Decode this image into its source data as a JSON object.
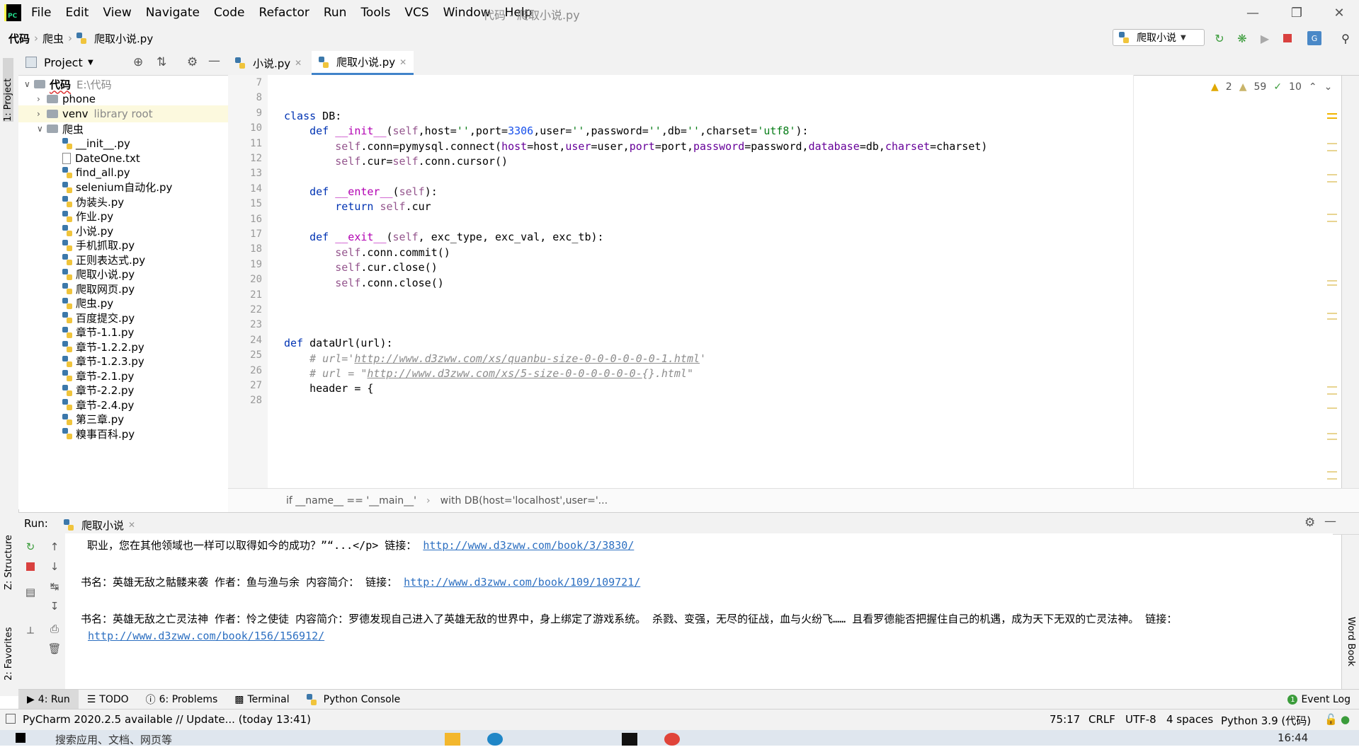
{
  "menubar": {
    "items": [
      "File",
      "Edit",
      "View",
      "Navigate",
      "Code",
      "Refactor",
      "Run",
      "Tools",
      "VCS",
      "Window",
      "Help"
    ],
    "title": "代码 - 爬取小说.py",
    "logo": "PC"
  },
  "navbar": {
    "crumbs": [
      "代码",
      "爬虫",
      "爬取小说.py"
    ],
    "run_config": "爬取小说"
  },
  "left_strip": {
    "project": "1: Project",
    "structure": "Z: Structure",
    "favorites": "2: Favorites"
  },
  "right_strip": {
    "wordbook": "Word Book"
  },
  "project": {
    "title": "Project",
    "root": {
      "name": "代码",
      "path": "E:\\代码"
    },
    "items": [
      {
        "name": "phone",
        "type": "folder"
      },
      {
        "name": "venv",
        "type": "folder",
        "note": "library root"
      },
      {
        "name": "爬虫",
        "type": "folder"
      },
      {
        "name": "__init__.py",
        "type": "py"
      },
      {
        "name": "DateOne.txt",
        "type": "txt"
      },
      {
        "name": "find_all.py",
        "type": "py"
      },
      {
        "name": "selenium自动化.py",
        "type": "py"
      },
      {
        "name": "伪装头.py",
        "type": "py"
      },
      {
        "name": "作业.py",
        "type": "py"
      },
      {
        "name": "小说.py",
        "type": "py"
      },
      {
        "name": "手机抓取.py",
        "type": "py"
      },
      {
        "name": "正则表达式.py",
        "type": "py"
      },
      {
        "name": "爬取小说.py",
        "type": "py"
      },
      {
        "name": "爬取网页.py",
        "type": "py"
      },
      {
        "name": "爬虫.py",
        "type": "py"
      },
      {
        "name": "百度提交.py",
        "type": "py"
      },
      {
        "name": "章节-1.1.py",
        "type": "py"
      },
      {
        "name": "章节-1.2.2.py",
        "type": "py"
      },
      {
        "name": "章节-1.2.3.py",
        "type": "py"
      },
      {
        "name": "章节-2.1.py",
        "type": "py"
      },
      {
        "name": "章节-2.2.py",
        "type": "py"
      },
      {
        "name": "章节-2.4.py",
        "type": "py"
      },
      {
        "name": "第三章.py",
        "type": "py"
      },
      {
        "name": "糗事百科.py",
        "type": "py"
      }
    ]
  },
  "editor": {
    "tabs": [
      {
        "label": "小说.py",
        "active": false
      },
      {
        "label": "爬取小说.py",
        "active": true
      }
    ],
    "inspections": {
      "warnings": "2",
      "weak_warnings": "59",
      "typos": "10"
    },
    "line_numbers": [
      "7",
      "8",
      "9",
      "10",
      "11",
      "12",
      "13",
      "14",
      "15",
      "16",
      "17",
      "18",
      "19",
      "20",
      "21",
      "22",
      "23",
      "24",
      "25",
      "26",
      "27",
      "28"
    ],
    "breadcrumb": [
      "if __name__ == '__main__'",
      "with DB(host='localhost',user='..."
    ]
  },
  "run": {
    "label": "Run:",
    "tab": "爬取小说",
    "lines": [
      "职业，您在其他领域也一样可以取得如今的成功？”“...</p> 链接： ",
      "http://www.d3zww.com/book/3/3830/",
      "书名：英雄无敌之骷髅来袭 作者：鱼与渔与余 内容简介：  链接： ",
      "http://www.d3zww.com/book/109/109721/",
      "书名：英雄无敌之亡灵法神 作者：怜之使徒 内容简介：罗德发现自己进入了英雄无敌的世界中，身上绑定了游戏系统。    杀戮、变强，无尽的征战，血与火纷飞……    且看罗德能否把握住自己的机遇，成为天下无双的亡灵法神。 链接：",
      "http://www.d3zww.com/book/156/156912/"
    ]
  },
  "bottombar": {
    "items": [
      "4: Run",
      "TODO",
      "6: Problems",
      "Terminal",
      "Python Console"
    ],
    "event_log": "Event Log"
  },
  "statusbar": {
    "message": "PyCharm 2020.2.5 available // Update... (today 13:41)",
    "position": "75:17",
    "line_sep": "CRLF",
    "encoding": "UTF-8",
    "indent": "4 spaces",
    "interpreter": "Python 3.9 (代码)"
  },
  "taskbar": {
    "search": "搜索应用、文档、网页等",
    "time": "16:44"
  }
}
